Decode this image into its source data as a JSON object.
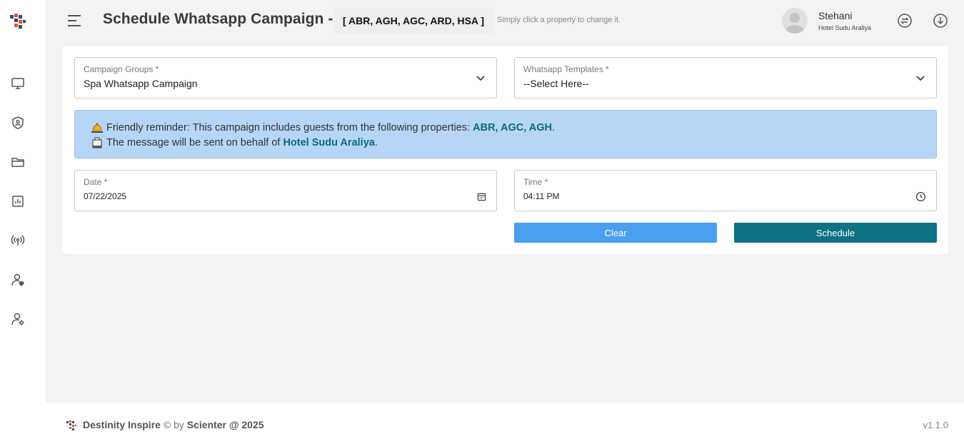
{
  "app": {
    "footer": {
      "brand": "Destinity Inspire",
      "by": "© by",
      "company": "Scienter @ 2025",
      "version": "v1.1.0"
    }
  },
  "sidebar": {
    "items": [
      {
        "icon": "monitor-icon",
        "label": "Dashboard"
      },
      {
        "icon": "shield-user-icon",
        "label": "Security"
      },
      {
        "icon": "folder-icon",
        "label": "Files"
      },
      {
        "icon": "report-icon",
        "label": "Reports"
      },
      {
        "icon": "broadcast-icon",
        "label": "Campaigns"
      },
      {
        "icon": "user-heart-icon",
        "label": "Guests"
      },
      {
        "icon": "user-settings-icon",
        "label": "User Settings"
      }
    ]
  },
  "header": {
    "title": "Schedule Whatsapp Campaign -",
    "properties": "[ ABR, AGH, AGC, ARD, HSA ]",
    "hint": "Simply click a property to change it.",
    "user_name": "Stehani",
    "user_hotel": "Hotel Sudu Araliya"
  },
  "form": {
    "campaign_groups": {
      "label": "Campaign Groups *",
      "value": "Spa Whatsapp Campaign"
    },
    "whatsapp_templates": {
      "label": "Whatsapp Templates *",
      "value": "--Select Here--"
    },
    "date": {
      "label": "Date *",
      "value": "07/22/2025"
    },
    "time": {
      "label": "Time *",
      "value": "04:11 PM"
    },
    "clear_label": "Clear",
    "schedule_label": "Schedule"
  },
  "alert": {
    "line1_text": "Friendly reminder: This campaign includes guests from the following properties:",
    "line1_props": "ABR, AGC, AGH",
    "line1_end": ".",
    "line2_text": "The message will be sent on behalf of",
    "line2_hotel": "Hotel Sudu Araliya",
    "line2_end": "."
  },
  "colors": {
    "primary": "#0d7283",
    "clear_button": "#4a9ff0",
    "alert_bg": "#b6d6f7"
  }
}
